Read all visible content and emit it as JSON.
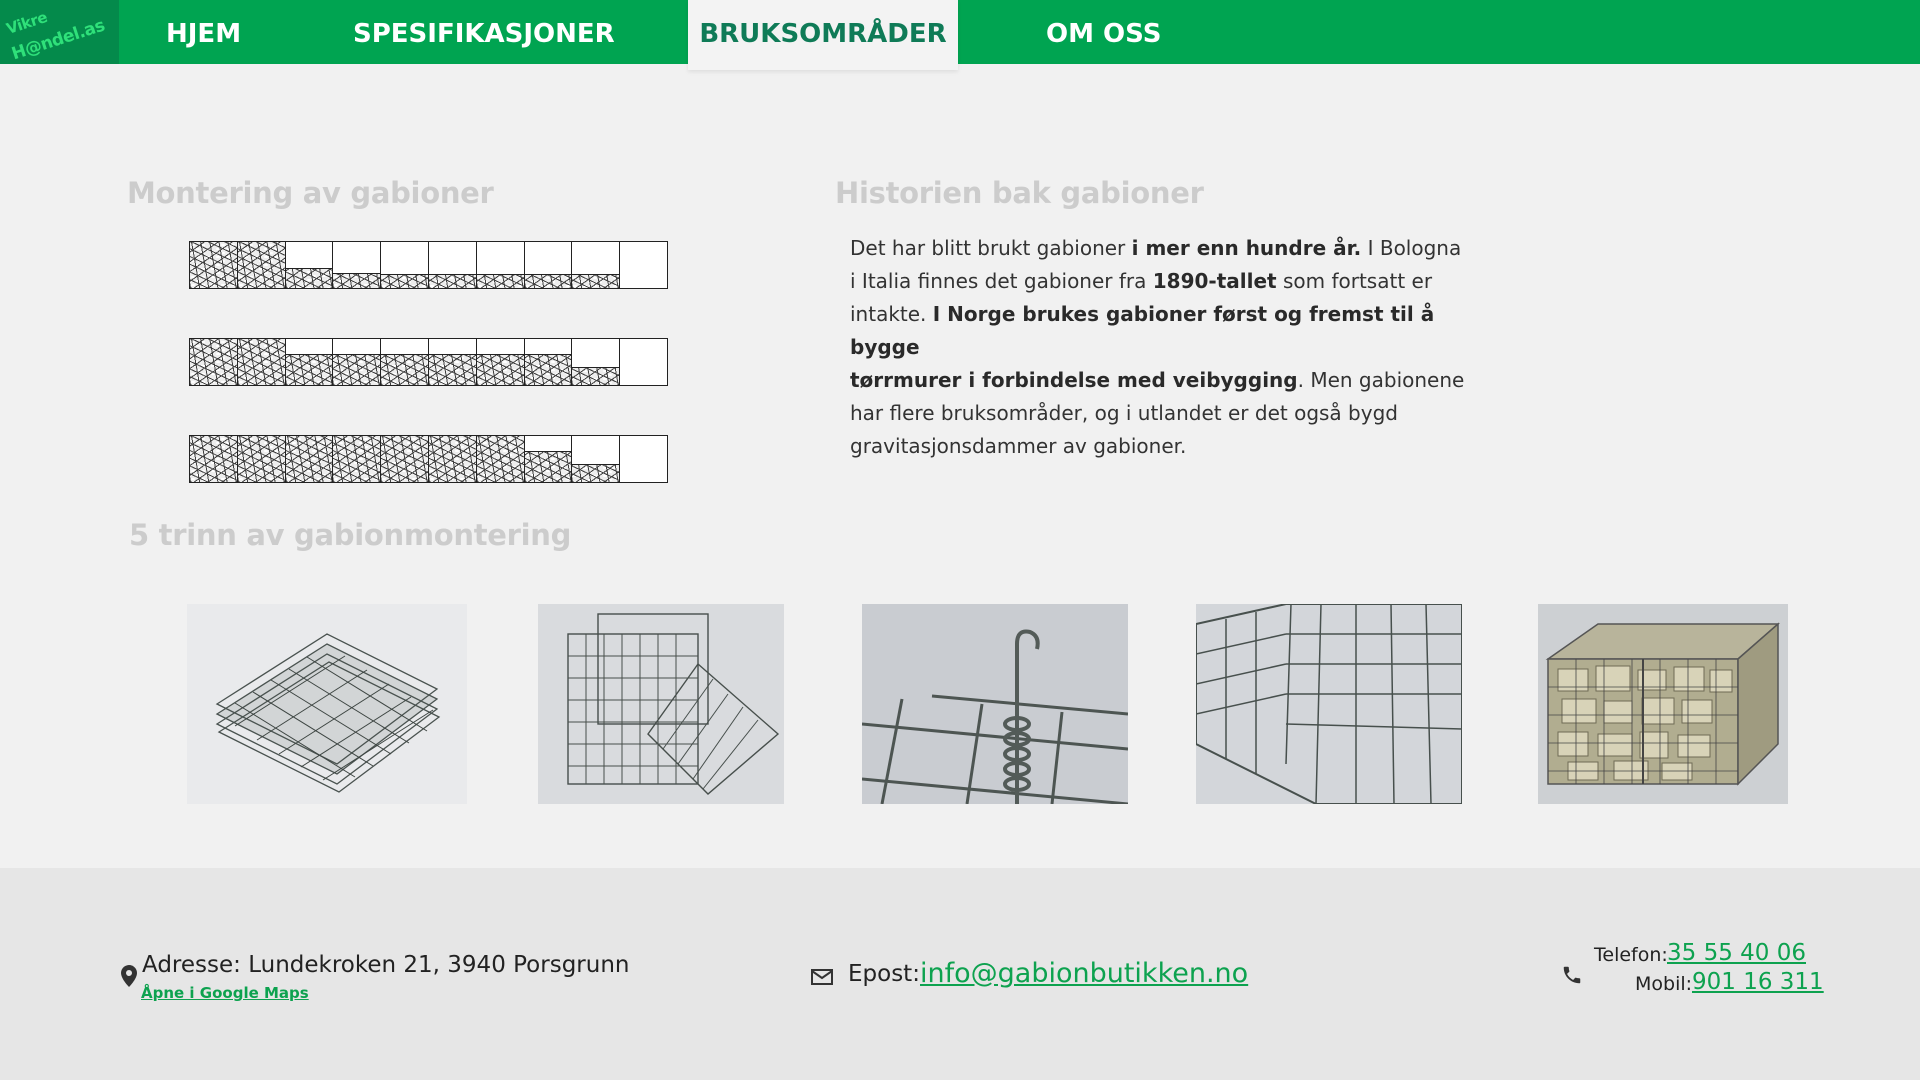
{
  "logo": {
    "line1": "Vikre",
    "line2": "H@ndel.as"
  },
  "nav": {
    "items": [
      {
        "label": "HJEM"
      },
      {
        "label": "SPESIFIKASJONER"
      },
      {
        "label": "BRUKSOMRÅDER"
      },
      {
        "label": "OM OSS"
      }
    ],
    "active_index": 2
  },
  "montering": {
    "title": "Montering av gabioner",
    "rows_filled": [
      [
        1,
        1,
        0.42,
        0.3,
        0.28,
        0.28,
        0.28,
        0.28,
        0.28,
        0
      ],
      [
        1,
        1,
        0.65,
        0.65,
        0.65,
        0.65,
        0.65,
        0.65,
        0.38,
        0
      ],
      [
        1,
        1,
        1,
        1,
        1,
        1,
        1,
        0.65,
        0.38,
        0
      ]
    ]
  },
  "history": {
    "title": "Historien bak gabioner",
    "paragraph": [
      {
        "t": "Det har blitt brukt gabioner ",
        "b": false
      },
      {
        "t": "i mer enn hundre år.",
        "b": true
      },
      {
        "t": " I Bologna\ni Italia finnes det gabioner fra ",
        "b": false
      },
      {
        "t": "1890-tallet",
        "b": true
      },
      {
        "t": " som fortsatt er\nintakte. ",
        "b": false
      },
      {
        "t": "I Norge brukes gabioner først og fremst til å bygge\ntørrmurer i forbindelse med veibygging",
        "b": true
      },
      {
        "t": ". Men gabionene\nhar flere bruksområder, og i utlandet er det også bygd\ngravitasjonsdammer av gabioner.",
        "b": false
      }
    ]
  },
  "steps": {
    "title": "5 trinn av gabionmontering",
    "images": [
      {
        "icon": "stacked-mesh-panels-photo"
      },
      {
        "icon": "unfolded-mesh-box-photo"
      },
      {
        "icon": "spiral-binder-photo"
      },
      {
        "icon": "mesh-corner-photo"
      },
      {
        "icon": "filled-gabion-photo"
      }
    ]
  },
  "footer": {
    "address_label": "Adresse: Lundekroken 21, 3940 Porsgrunn",
    "maps_link": "Åpne  i Google Maps",
    "email_label": "Epost:",
    "email_value": "info@gabionbutikken.no",
    "phone_label": "Telefon:",
    "phone_value": "35 55 40 06",
    "mobile_label": "Mobil:",
    "mobile_value": "901 16 311"
  },
  "colors": {
    "nav_green": "#00a451",
    "active_text": "#0f7b57",
    "link_green": "#0da24f"
  }
}
